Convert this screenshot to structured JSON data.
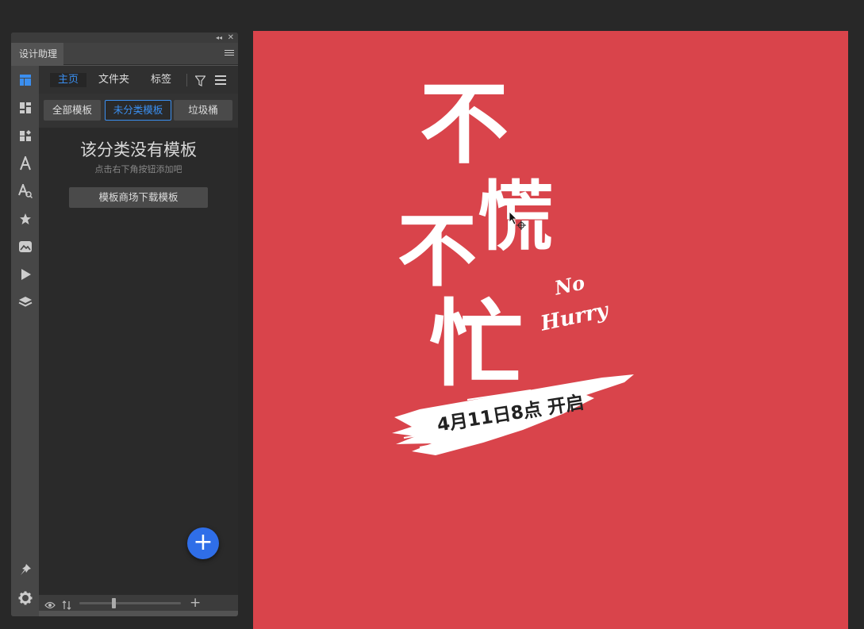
{
  "panel": {
    "title": "设计助理",
    "nav": {
      "home": "主页",
      "folders": "文件夹",
      "tags": "标签"
    },
    "filters": {
      "all": "全部模板",
      "uncategorized": "未分类模板",
      "trash": "垃圾桶"
    },
    "empty": {
      "title": "该分类没有模板",
      "subtitle": "点击右下角按钮添加吧",
      "store_button": "模板商场下载模板"
    }
  },
  "poster": {
    "line1": "不",
    "line2a": "慌",
    "line2b": "不",
    "line3": "忙",
    "english_1": "No",
    "english_2": "Hurry",
    "date": "4月11日8点 开启"
  },
  "colors": {
    "accent": "#3b8ff0",
    "fab": "#2f6ee8",
    "poster_bg": "#d9444b"
  }
}
